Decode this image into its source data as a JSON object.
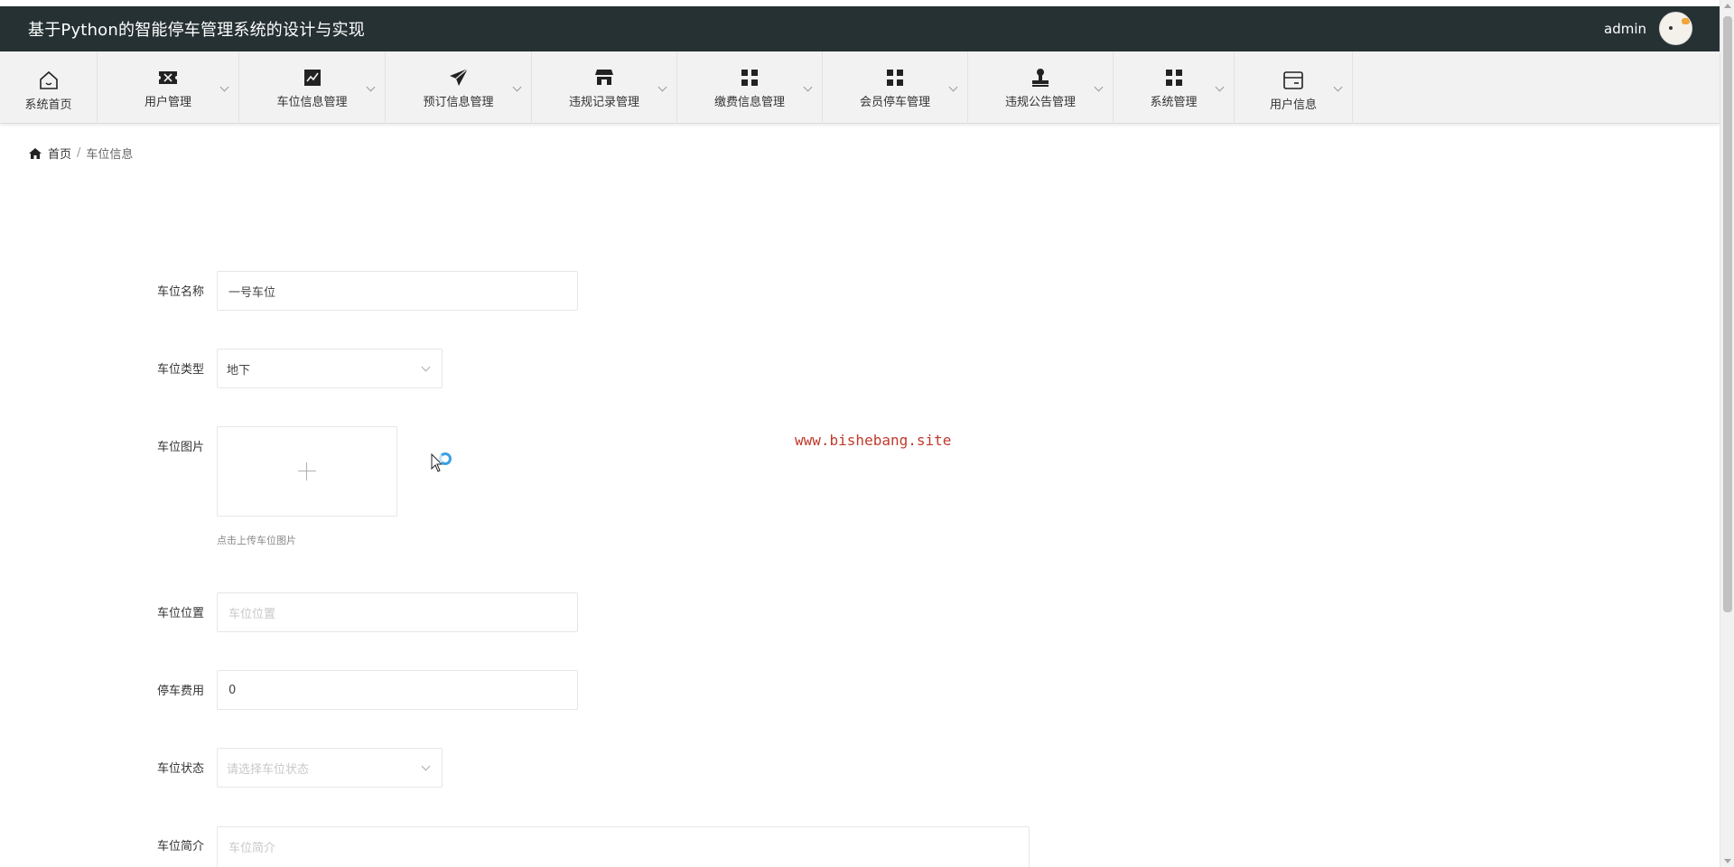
{
  "header": {
    "title": "基于Python的智能停车管理系统的设计与实现",
    "username": "admin"
  },
  "nav": [
    {
      "label": "系统首页",
      "icon": "home-icon",
      "dropdown": false
    },
    {
      "label": "用户管理",
      "icon": "ticket-icon",
      "dropdown": true
    },
    {
      "label": "车位信息管理",
      "icon": "chart-line-icon",
      "dropdown": true
    },
    {
      "label": "预订信息管理",
      "icon": "paper-plane-icon",
      "dropdown": true
    },
    {
      "label": "违规记录管理",
      "icon": "store-icon",
      "dropdown": true
    },
    {
      "label": "缴费信息管理",
      "icon": "grid-icon",
      "dropdown": true
    },
    {
      "label": "会员停车管理",
      "icon": "grid-icon",
      "dropdown": true
    },
    {
      "label": "违规公告管理",
      "icon": "stamp-icon",
      "dropdown": true
    },
    {
      "label": "系统管理",
      "icon": "grid-icon",
      "dropdown": true
    },
    {
      "label": "用户信息",
      "icon": "card-icon",
      "dropdown": true
    }
  ],
  "breadcrumb": {
    "home": "首页",
    "separator": "/",
    "current": "车位信息"
  },
  "watermark": "www.bishebang.site",
  "form": {
    "name": {
      "label": "车位名称",
      "value": "一号车位"
    },
    "type": {
      "label": "车位类型",
      "value": "地下"
    },
    "image": {
      "label": "车位图片",
      "hint": "点击上传车位图片"
    },
    "location": {
      "label": "车位位置",
      "placeholder": "车位位置"
    },
    "fee": {
      "label": "停车费用",
      "value": "0"
    },
    "status": {
      "label": "车位状态",
      "placeholder": "请选择车位状态"
    },
    "intro": {
      "label": "车位简介",
      "placeholder": "车位简介"
    }
  },
  "colors": {
    "header_bg": "#263133",
    "nav_bg": "#f2f2f2",
    "watermark": "#c0392b"
  }
}
